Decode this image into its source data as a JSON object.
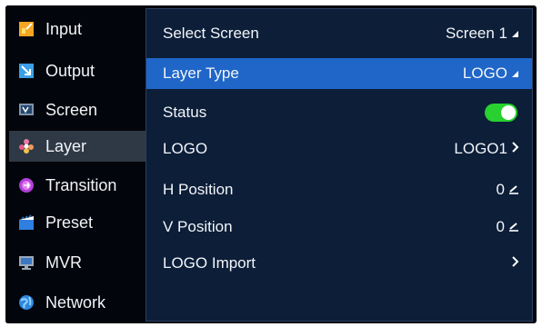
{
  "sidebar": {
    "items": [
      {
        "label": "Input",
        "icon": "input-icon"
      },
      {
        "label": "Output",
        "icon": "output-icon"
      },
      {
        "label": "Screen",
        "icon": "screen-icon"
      },
      {
        "label": "Layer",
        "icon": "layer-icon",
        "active": true
      },
      {
        "label": "Transition",
        "icon": "transition-icon"
      },
      {
        "label": "Preset",
        "icon": "preset-icon"
      },
      {
        "label": "MVR",
        "icon": "mvr-icon"
      },
      {
        "label": "Network",
        "icon": "network-icon"
      }
    ]
  },
  "main": {
    "rows": [
      {
        "label": "Select Screen",
        "value": "Screen 1",
        "indicator": "dropdown-triangle-icon"
      },
      {
        "label": "Layer Type",
        "value": "LOGO",
        "indicator": "dropdown-triangle-icon",
        "selected": true
      },
      {
        "label": "Status",
        "indicator": "toggle-switch",
        "toggle_on": true
      },
      {
        "label": "LOGO",
        "value": "LOGO1",
        "indicator": "chevron-right-icon"
      },
      {
        "label": "H Position",
        "value": "0",
        "indicator": "edit-icon"
      },
      {
        "label": "V Position",
        "value": "0",
        "indicator": "edit-icon"
      },
      {
        "label": "LOGO Import",
        "indicator": "chevron-right-icon"
      }
    ]
  },
  "colors": {
    "selected_row": "#1f66c8",
    "active_sidebar": "#2f3845",
    "panel_background": "#0c1e38",
    "toggle_on": "#28d12f"
  }
}
